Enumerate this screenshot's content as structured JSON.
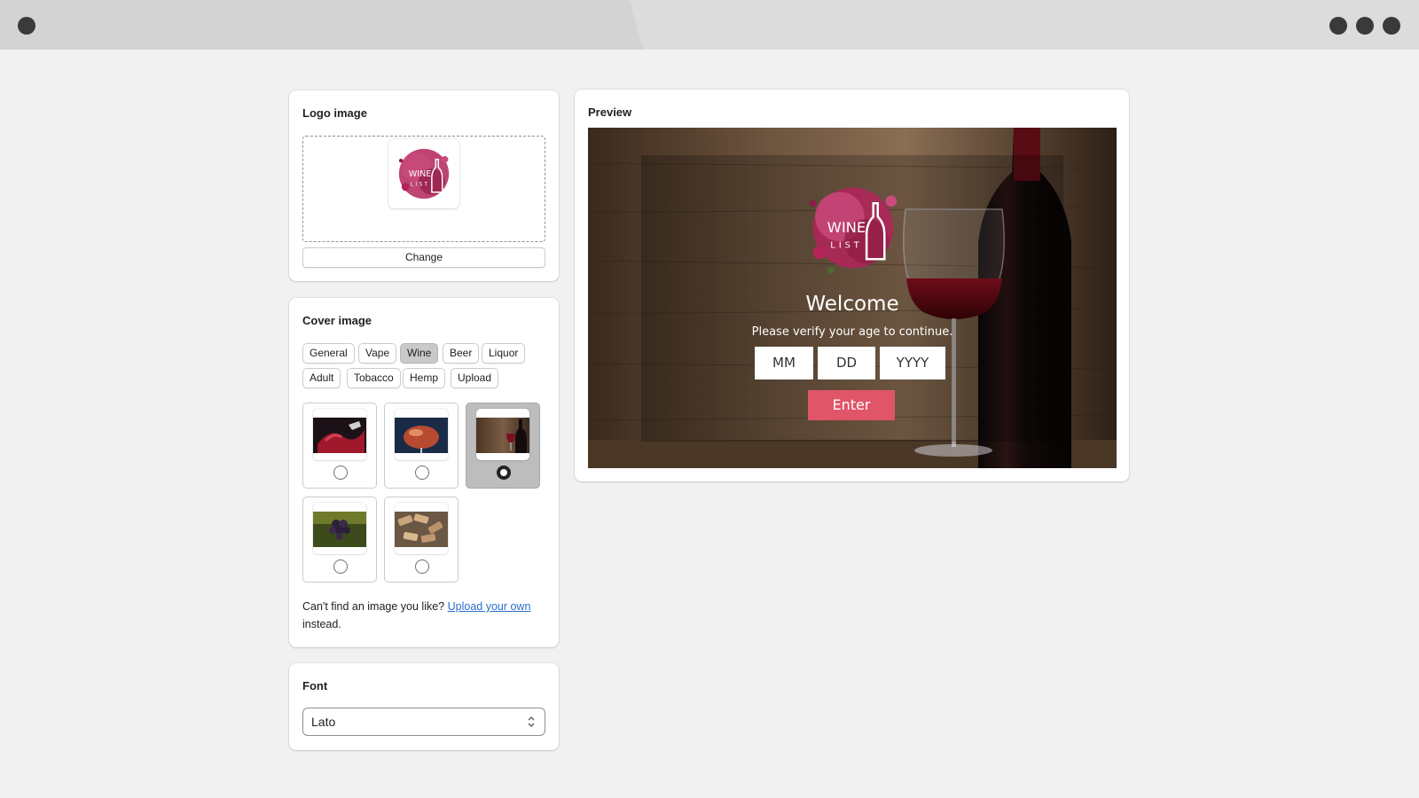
{
  "logo_card": {
    "title": "Logo image",
    "change_label": "Change",
    "logo_text_top": "WINE",
    "logo_text_bottom": "LIST"
  },
  "cover_card": {
    "title": "Cover image",
    "categories": [
      {
        "label": "General",
        "active": false
      },
      {
        "label": "Vape",
        "active": false
      },
      {
        "label": "Wine",
        "active": true
      },
      {
        "label": "Beer",
        "active": false
      },
      {
        "label": "Liquor",
        "active": false
      },
      {
        "label": "Adult",
        "active": false
      },
      {
        "label": "Tobacco",
        "active": false
      },
      {
        "label": "Hemp",
        "active": false
      },
      {
        "label": "Upload",
        "active": false
      }
    ],
    "images": [
      {
        "icon": "red-wine-splash-thumbnail",
        "selected": false
      },
      {
        "icon": "wine-glass-closeup-thumbnail",
        "selected": false
      },
      {
        "icon": "wine-bottle-and-glass-thumbnail",
        "selected": true
      },
      {
        "icon": "grapes-thumbnail",
        "selected": false
      },
      {
        "icon": "wine-corks-thumbnail",
        "selected": false
      }
    ],
    "help_prefix": "Can't find an image you like?",
    "help_link": "Upload your own",
    "help_suffix": "instead."
  },
  "font_card": {
    "title": "Font",
    "selected_font": "Lato"
  },
  "preview_card": {
    "title": "Preview",
    "welcome": "Welcome",
    "subtitle": "Please verify your age to continue.",
    "mm_placeholder": "MM",
    "dd_placeholder": "DD",
    "yyyy_placeholder": "YYYY",
    "enter_label": "Enter",
    "enter_color": "#e05568"
  },
  "colors": {
    "link": "#2c6ecb",
    "logo_accent": "#b3245a"
  }
}
